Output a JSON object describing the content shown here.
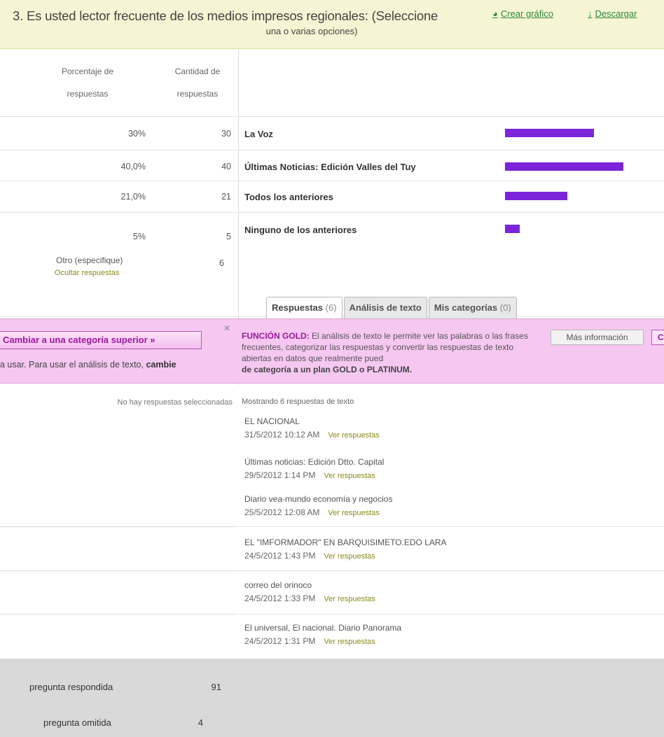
{
  "header": {
    "question_line1": "3. Es usted lector frecuente de los medios impresos regionales: (Seleccione",
    "question_line2": "una o varias opciones)",
    "create_chart": "Crear gráfico",
    "download": "Descargar"
  },
  "table": {
    "col_pct_line1": "Porcentaje de",
    "col_pct_line2": "respuestas",
    "col_cnt_line1": "Cantidad de",
    "col_cnt_line2": "respuestas",
    "rows": [
      {
        "pct": "30%",
        "count": "30",
        "label": "La Voz",
        "value": 30
      },
      {
        "pct": "40,0%",
        "count": "40",
        "label": "Últimas Noticias: Edición Valles del Tuy",
        "value": 40
      },
      {
        "pct": "21,0%",
        "count": "21",
        "label": "Todos los anteriores",
        "value": 21
      },
      {
        "pct": "5%",
        "count": "5",
        "label": "Ninguno de los anteriores",
        "value": 5
      }
    ],
    "other_label": "Otro (especifique)",
    "other_count": "6",
    "hide_responses": "Ocultar respuestas"
  },
  "tabs": {
    "responses_label": "Respuestas",
    "responses_count": "(6)",
    "text_analysis": "Análisis de texto",
    "my_categories_label": "Mis categorías",
    "my_categories_count": "(0)"
  },
  "upsell": {
    "upgrade_button": "Cambiar a una categoría superior »",
    "close": "✕",
    "left_text": "a usar. Para usar el análisis de texto,",
    "left_text_bold": "cambie",
    "gold_label": "FUNCIÓN GOLD:",
    "gold_text": "El análisis de texto le permite ver las palabras o las frases frecuentes, categorizar las respuestas y convertir las respuestas de texto abiertas en datos que realmente pued",
    "gold_text_bold": "de categoría a un plan GOLD o PLATINUM.",
    "more_info": "Más información",
    "edge_btn": "C"
  },
  "responses": {
    "no_selected": "No hay respuestas seleccionadas",
    "showing": "Mostrando 6 respuestas de texto",
    "view_label": "Ver respuestas",
    "items": [
      {
        "text": "EL NACIONAL",
        "date": "31/5/2012 10:12 AM"
      },
      {
        "text": "Últimas noticias: Edición Dtto. Capital",
        "date": "29/5/2012 1:14 PM"
      },
      {
        "text": "Diario vea-mundo economía y negocios",
        "date": "25/5/2012 12:08 AM"
      },
      {
        "text": "EL \"IMFORMADOR\" EN BARQUISIMETO.EDO LARA",
        "date": "24/5/2012 1:43 PM"
      },
      {
        "text": "correo del orinoco",
        "date": "24/5/2012 1:33 PM"
      },
      {
        "text": "El universal, El nacional. Diario Panorama",
        "date": "24/5/2012 1:31 PM"
      }
    ]
  },
  "footer": {
    "answered_label": "pregunta respondida",
    "answered_value": "91",
    "skipped_label": "pregunta omitida",
    "skipped_value": "4"
  },
  "colors": {
    "bar": "#7b24d9",
    "upsell_bg": "#f5c7f1",
    "header_bg": "#f5f5d3",
    "link_green": "#2c8a3a"
  },
  "icons": [
    "chart-icon",
    "download-icon",
    "close-icon"
  ]
}
